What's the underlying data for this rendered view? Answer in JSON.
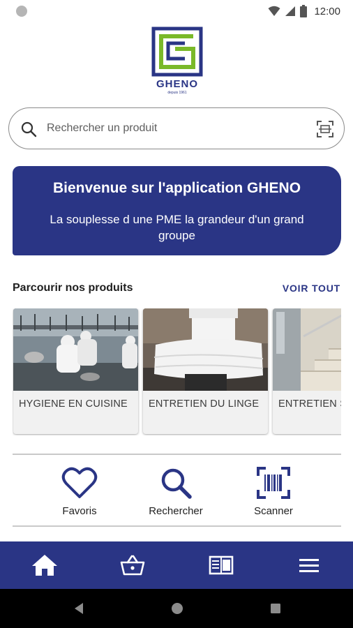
{
  "status_bar": {
    "time": "12:00"
  },
  "logo": {
    "name": "GHENO",
    "tagline": "depuis 1961"
  },
  "search": {
    "placeholder": "Rechercher un produit"
  },
  "banner": {
    "title": "Bienvenue sur l'application GHENO",
    "text": "La souplesse d une PME la grandeur d'un grand groupe"
  },
  "products": {
    "title": "Parcourir nos produits",
    "see_all": "VOIR TOUT",
    "categories": [
      {
        "label": "HYGIENE EN CUISINE"
      },
      {
        "label": "ENTRETIEN DU LINGE"
      },
      {
        "label": "ENTRETIEN SOLS"
      }
    ]
  },
  "quick_actions": {
    "favorites": "Favoris",
    "search": "Rechercher",
    "scanner": "Scanner"
  },
  "colors": {
    "brand_blue": "#2a3585",
    "brand_green": "#7ab929"
  },
  "icons": {
    "bottom_nav": [
      "home-icon",
      "basket-icon",
      "catalog-icon",
      "menu-icon"
    ]
  }
}
